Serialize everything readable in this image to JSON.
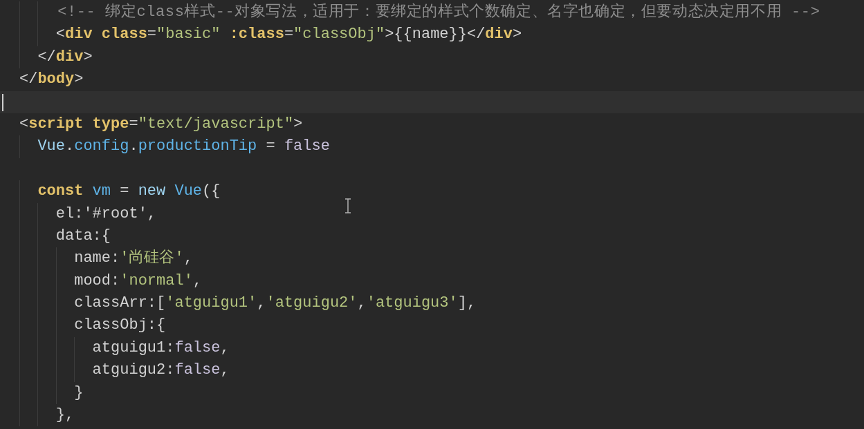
{
  "editor": {
    "lines": [
      {
        "current": false,
        "tokens": [
          {
            "kind": "comment",
            "text": "    <!-- 绑定class样式--对象写法，适用于：要绑定的样式个数确定、名字也确定，但要动态决定用不用 -->"
          }
        ]
      },
      {
        "current": false,
        "tokens": [
          {
            "kind": "punct",
            "text": "    <"
          },
          {
            "kind": "tag",
            "text": "div"
          },
          {
            "kind": "attr",
            "text": " class"
          },
          {
            "kind": "punct",
            "text": "="
          },
          {
            "kind": "string",
            "text": "\"basic\""
          },
          {
            "kind": "attr",
            "text": " :class"
          },
          {
            "kind": "punct",
            "text": "="
          },
          {
            "kind": "string",
            "text": "\"classObj\""
          },
          {
            "kind": "punct",
            "text": ">{{"
          },
          {
            "kind": "plain",
            "text": "name"
          },
          {
            "kind": "punct",
            "text": "}}</"
          },
          {
            "kind": "tag",
            "text": "div"
          },
          {
            "kind": "punct",
            "text": ">"
          }
        ]
      },
      {
        "current": false,
        "tokens": [
          {
            "kind": "punct",
            "text": "  </"
          },
          {
            "kind": "tag",
            "text": "div"
          },
          {
            "kind": "punct",
            "text": ">"
          }
        ]
      },
      {
        "current": false,
        "tokens": [
          {
            "kind": "punct",
            "text": "</"
          },
          {
            "kind": "tag",
            "text": "body"
          },
          {
            "kind": "punct",
            "text": ">"
          }
        ]
      },
      {
        "current": true
      },
      {
        "current": false,
        "tokens": [
          {
            "kind": "punct",
            "text": "<"
          },
          {
            "kind": "tag",
            "text": "script"
          },
          {
            "kind": "attr",
            "text": " type"
          },
          {
            "kind": "punct",
            "text": "="
          },
          {
            "kind": "string",
            "text": "\"text/javascript\""
          },
          {
            "kind": "punct",
            "text": ">"
          }
        ]
      },
      {
        "current": false,
        "tokens": [
          {
            "kind": "ident",
            "text": "  Vue"
          },
          {
            "kind": "punct",
            "text": "."
          },
          {
            "kind": "prop",
            "text": "config"
          },
          {
            "kind": "punct",
            "text": "."
          },
          {
            "kind": "prop",
            "text": "productionTip"
          },
          {
            "kind": "punct",
            "text": " = "
          },
          {
            "kind": "bool",
            "text": "false"
          }
        ]
      },
      {
        "current": false
      },
      {
        "current": false,
        "tokens": [
          {
            "kind": "keyword",
            "text": "  const"
          },
          {
            "kind": "prop",
            "text": " vm"
          },
          {
            "kind": "punct",
            "text": " = "
          },
          {
            "kind": "ident",
            "text": "new"
          },
          {
            "kind": "prop",
            "text": " Vue"
          },
          {
            "kind": "punct",
            "text": "({"
          }
        ]
      },
      {
        "current": false,
        "tokens": [
          {
            "kind": "plain",
            "text": "    el:"
          },
          {
            "kind": "plain",
            "text": "'#root'"
          },
          {
            "kind": "punct",
            "text": ","
          }
        ]
      },
      {
        "current": false,
        "tokens": [
          {
            "kind": "plain",
            "text": "    data:{"
          }
        ]
      },
      {
        "current": false,
        "tokens": [
          {
            "kind": "plain",
            "text": "      name:"
          },
          {
            "kind": "string",
            "text": "'尚硅谷'"
          },
          {
            "kind": "punct",
            "text": ","
          }
        ]
      },
      {
        "current": false,
        "tokens": [
          {
            "kind": "plain",
            "text": "      mood:"
          },
          {
            "kind": "string",
            "text": "'normal'"
          },
          {
            "kind": "punct",
            "text": ","
          }
        ]
      },
      {
        "current": false,
        "tokens": [
          {
            "kind": "plain",
            "text": "      classArr:["
          },
          {
            "kind": "string",
            "text": "'atguigu1'"
          },
          {
            "kind": "punct",
            "text": ","
          },
          {
            "kind": "string",
            "text": "'atguigu2'"
          },
          {
            "kind": "punct",
            "text": ","
          },
          {
            "kind": "string",
            "text": "'atguigu3'"
          },
          {
            "kind": "punct",
            "text": "],"
          }
        ]
      },
      {
        "current": false,
        "tokens": [
          {
            "kind": "plain",
            "text": "      classObj:{"
          }
        ]
      },
      {
        "current": false,
        "tokens": [
          {
            "kind": "plain",
            "text": "        atguigu1:"
          },
          {
            "kind": "bool",
            "text": "false"
          },
          {
            "kind": "punct",
            "text": ","
          }
        ]
      },
      {
        "current": false,
        "tokens": [
          {
            "kind": "plain",
            "text": "        atguigu2:"
          },
          {
            "kind": "bool",
            "text": "false"
          },
          {
            "kind": "punct",
            "text": ","
          }
        ]
      },
      {
        "current": false,
        "tokens": [
          {
            "kind": "plain",
            "text": "      }"
          }
        ]
      },
      {
        "current": false,
        "tokens": [
          {
            "kind": "plain",
            "text": "    },"
          }
        ]
      }
    ]
  }
}
